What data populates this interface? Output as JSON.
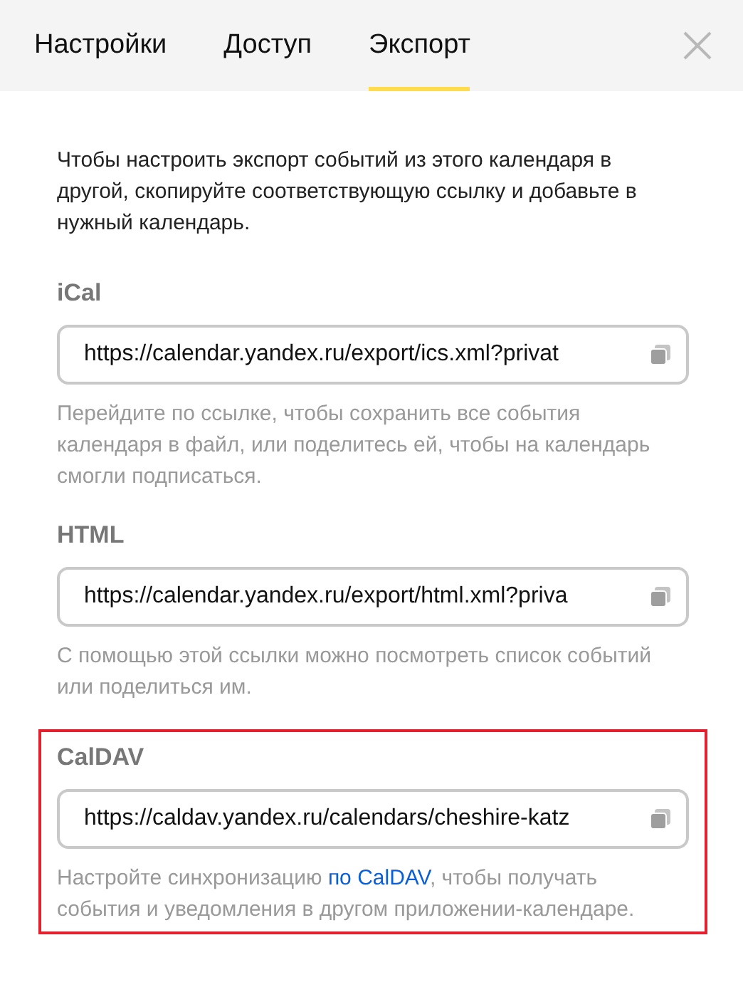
{
  "tabs": [
    {
      "label": "Настройки",
      "selected": false
    },
    {
      "label": "Доступ",
      "selected": false
    },
    {
      "label": "Экспорт",
      "selected": true
    }
  ],
  "intro": "Чтобы настроить экспорт событий из этого календаря в другой, скопируйте соответствующую ссылку и добавьте в нужный календарь.",
  "sections": [
    {
      "label": "iCal",
      "value": "https://calendar.yandex.ru/export/ics.xml?privat",
      "highlighted": false,
      "help": [
        {
          "text": "Перейдите по ссылке, чтобы сохранить все события календаря в файл, или поделитесь ей, чтобы на календарь смогли подписаться.",
          "kind": "text"
        }
      ]
    },
    {
      "label": "HTML",
      "value": "https://calendar.yandex.ru/export/html.xml?priva",
      "highlighted": false,
      "help": [
        {
          "text": "С помощью этой ссылки можно посмотреть список событий или поделиться им.",
          "kind": "text"
        }
      ]
    },
    {
      "label": "CalDAV",
      "value": "https://caldav.yandex.ru/calendars/cheshire-katz",
      "highlighted": true,
      "help": [
        {
          "text": "Настройте синхронизацию ",
          "kind": "text"
        },
        {
          "text": "по CalDAV",
          "kind": "link"
        },
        {
          "text": ", чтобы получать события и уведомления в другом приложении-календаре.",
          "kind": "text"
        }
      ]
    }
  ]
}
